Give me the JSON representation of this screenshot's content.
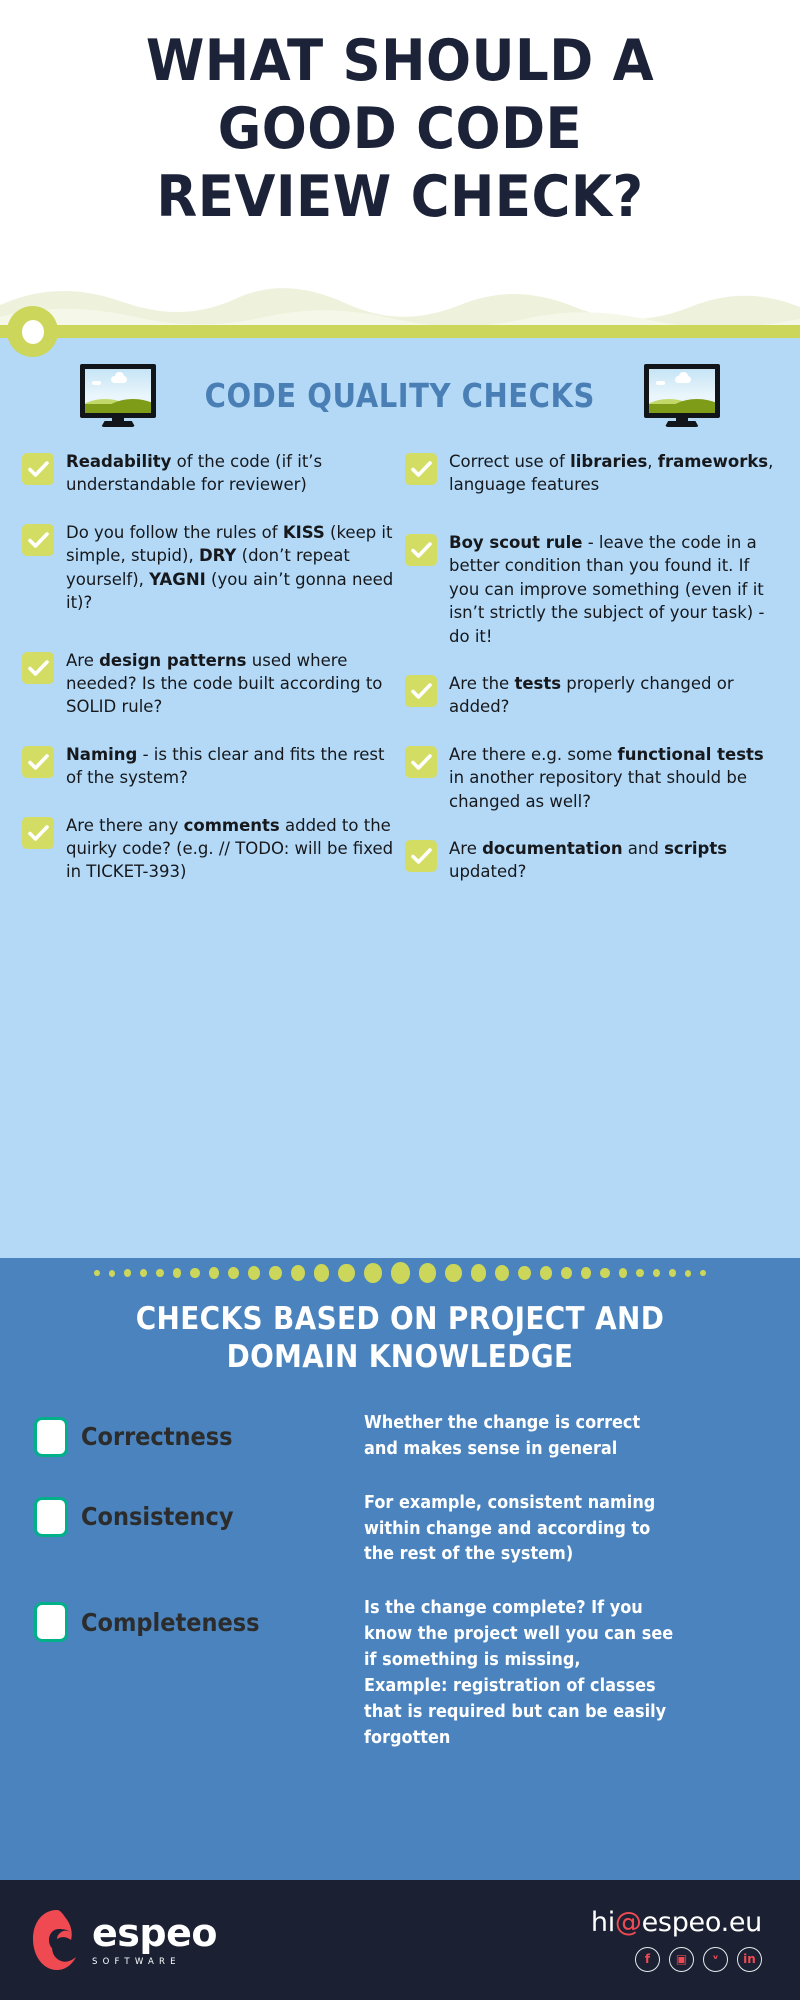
{
  "hero": {
    "title_lines": [
      "WHAT SHOULD A",
      "GOOD CODE",
      "REVIEW CHECK?"
    ]
  },
  "colors": {
    "navy": "#1c2338",
    "lime": "#cbd65a",
    "light_blue": "#b3d9f7",
    "mid_blue": "#4a83bd",
    "header_blue": "#4a7fb5",
    "checkbox_lime": "#d3dd64",
    "teal": "#00b089",
    "footer_dark": "#1b2133",
    "accent_red": "#ef4a52"
  },
  "quality_section": {
    "heading": "CODE QUALITY CHECKS",
    "left_icon": "monitor-icon",
    "right_icon": "monitor-icon",
    "left_column": [
      {
        "parts": [
          {
            "text": "Readability",
            "bold": true
          },
          {
            "text": " of the code (if it’s understandable for reviewer)",
            "bold": false
          }
        ]
      },
      {
        "parts": [
          {
            "text": "Do you follow the rules of ",
            "bold": false
          },
          {
            "text": "KISS",
            "bold": true
          },
          {
            "text": " (keep it simple, stupid), ",
            "bold": false
          },
          {
            "text": "DRY",
            "bold": true
          },
          {
            "text": " (don’t repeat yourself), ",
            "bold": false
          },
          {
            "text": "YAGNI",
            "bold": true
          },
          {
            "text": " (you ain’t gonna need it)?",
            "bold": false
          }
        ]
      },
      {
        "parts": [
          {
            "text": "Are ",
            "bold": false
          },
          {
            "text": "design patterns",
            "bold": true
          },
          {
            "text": " used where needed? Is the code built according to SOLID rule?",
            "bold": false
          }
        ]
      },
      {
        "parts": [
          {
            "text": "Naming",
            "bold": true
          },
          {
            "text": " - is this clear and fits the rest of the system?",
            "bold": false
          }
        ]
      },
      {
        "parts": [
          {
            "text": "Are there any ",
            "bold": false
          },
          {
            "text": "comments",
            "bold": true
          },
          {
            "text": " added to the quirky code? (e.g. // TODO: will be fixed in TICKET-393)",
            "bold": false
          }
        ]
      }
    ],
    "right_column": [
      {
        "parts": [
          {
            "text": "Correct use of ",
            "bold": false
          },
          {
            "text": "libraries",
            "bold": true
          },
          {
            "text": ", ",
            "bold": false
          },
          {
            "text": "frameworks",
            "bold": true
          },
          {
            "text": ", language features",
            "bold": false
          }
        ]
      },
      {
        "parts": [
          {
            "text": "Boy scout rule",
            "bold": true
          },
          {
            "text": " - leave the code in a better condition than you found it. If you can improve something (even if it isn’t strictly the subject of your task) - do it!",
            "bold": false
          }
        ]
      },
      {
        "parts": [
          {
            "text": "Are the ",
            "bold": false
          },
          {
            "text": "tests",
            "bold": true
          },
          {
            "text": " properly changed or added?",
            "bold": false
          }
        ]
      },
      {
        "parts": [
          {
            "text": "Are there e.g. some ",
            "bold": false
          },
          {
            "text": "functional tests",
            "bold": true
          },
          {
            "text": " in another repository that should be changed as well?",
            "bold": false
          }
        ]
      },
      {
        "parts": [
          {
            "text": "Are ",
            "bold": false
          },
          {
            "text": "documentation",
            "bold": true
          },
          {
            "text": " and ",
            "bold": false
          },
          {
            "text": "scripts",
            "bold": true
          },
          {
            "text": " updated?",
            "bold": false
          }
        ]
      }
    ]
  },
  "domain_section": {
    "title_lines": [
      "CHECKS BASED ON PROJECT AND",
      "DOMAIN KNOWLEDGE"
    ],
    "rows": [
      {
        "label": "Correctness",
        "desc_lines": [
          "Whether the change is correct",
          "and makes sense in general"
        ]
      },
      {
        "label": "Consistency",
        "desc_lines": [
          "For example, consistent naming",
          "within change and according to",
          "the rest of the system)"
        ]
      },
      {
        "label": "Completeness",
        "desc_lines": [
          "Is the change complete? If you",
          "know the project well you can see",
          "if something is missing,",
          "Example: registration of classes",
          "that is required but can be easily",
          "forgotten"
        ]
      }
    ]
  },
  "footer": {
    "logo_word": "espeo",
    "logo_sub": "SOFTWARE",
    "email_before": "hi",
    "email_at": "@",
    "email_after": "espeo.eu",
    "socials": [
      {
        "name": "facebook-icon",
        "glyph": "f"
      },
      {
        "name": "instagram-icon",
        "glyph": "▣"
      },
      {
        "name": "twitter-icon",
        "glyph": "ᵛ"
      },
      {
        "name": "linkedin-icon",
        "glyph": "in"
      }
    ]
  }
}
